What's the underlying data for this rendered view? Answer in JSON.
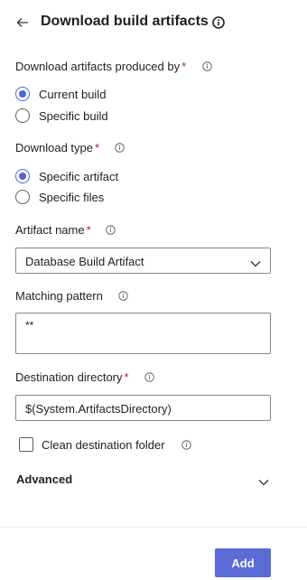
{
  "header": {
    "title": "Download build artifacts",
    "back_icon": "arrow-left-icon",
    "info_icon": "info-icon"
  },
  "form": {
    "artifacts_produced_by": {
      "label": "Download artifacts produced by",
      "required_mark": "*",
      "options": [
        "Current build",
        "Specific build"
      ],
      "selected": "Current build"
    },
    "download_type": {
      "label": "Download type",
      "required_mark": "*",
      "options": [
        "Specific artifact",
        "Specific files"
      ],
      "selected": "Specific artifact"
    },
    "artifact_name": {
      "label": "Artifact name",
      "required_mark": "*",
      "value": "Database Build Artifact"
    },
    "matching_pattern": {
      "label": "Matching pattern",
      "value": "**"
    },
    "destination_directory": {
      "label": "Destination directory",
      "required_mark": "*",
      "value": "$(System.ArtifactsDirectory)"
    },
    "clean_destination": {
      "label": "Clean destination folder",
      "checked": false
    },
    "advanced": {
      "label": "Advanced",
      "expanded": false
    }
  },
  "footer": {
    "add_label": "Add"
  },
  "colors": {
    "accent": "#4f63d8",
    "button": "#5a6bd8",
    "required": "#a4262c"
  }
}
